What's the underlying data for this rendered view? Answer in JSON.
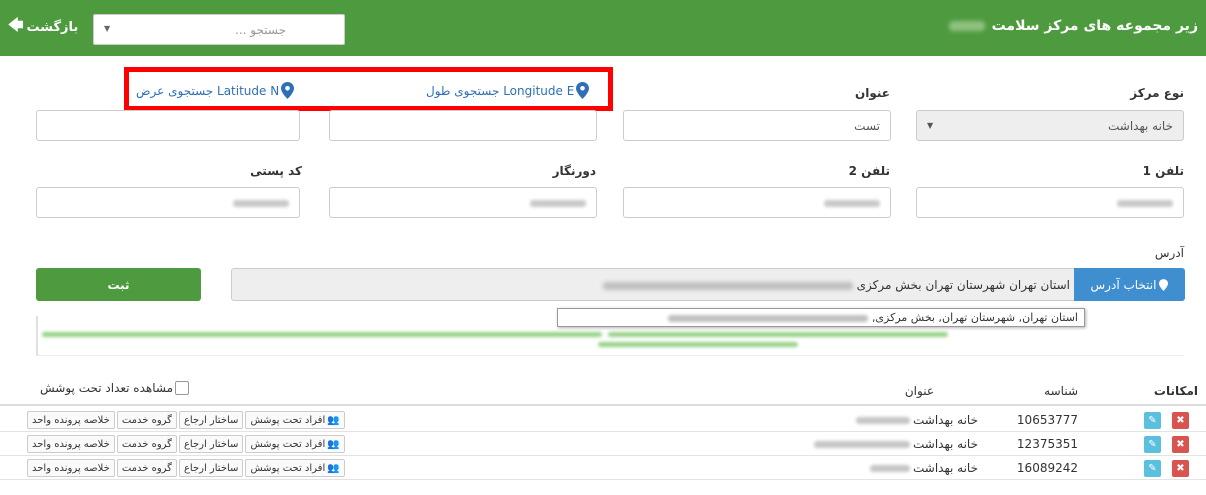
{
  "header": {
    "title": "زیر مجموعه های مرکز سلامت",
    "back_label": "بازگشت",
    "search_placeholder": "جستجو ...",
    "bg_color": "#4e9b3f"
  },
  "form": {
    "center_type_label": "نوع مرکز",
    "center_type_value": "خانه بهداشت",
    "title_label": "عنوان",
    "title_value": "تست",
    "longitude_link": "جستجوی طول Longitude E",
    "latitude_link": "جستجوی عرض Latitude N",
    "phone1_label": "تلفن 1",
    "phone2_label": "تلفن 2",
    "fax_label": "دورنگار",
    "postal_label": "کد پستی",
    "address_label": "آدرس",
    "address_button": "انتخاب آدرس",
    "address_value": "استان تهران شهرستان تهران بخش مرکزی",
    "tooltip_value": "استان تهران, شهرستان تهران, بخش مرکزی,",
    "submit_label": "ثبت"
  },
  "table": {
    "headers": {
      "actions": "امکانات",
      "id": "شناسه",
      "title": "عنوان",
      "show_covered": "مشاهده تعداد تحت پوشش"
    },
    "row_buttons": {
      "covered": "افراد تحت پوشش",
      "referral": "ساختار ارجاع",
      "service_group": "گروه خدمت",
      "file_summary": "خلاصه پرونده واحد"
    },
    "rows": [
      {
        "id": "10653777",
        "name": "خانه بهداشت"
      },
      {
        "id": "12375351",
        "name": "خانه بهداشت"
      },
      {
        "id": "16089242",
        "name": "خانه بهداشت"
      }
    ]
  }
}
